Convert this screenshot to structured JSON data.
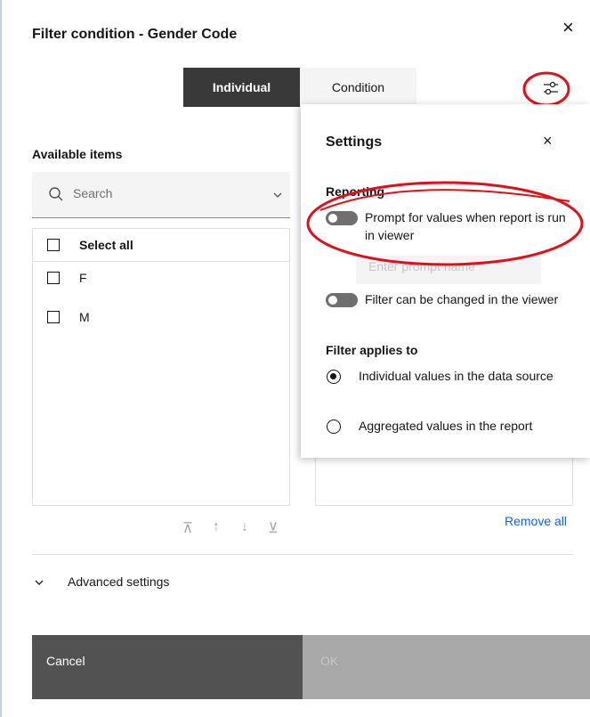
{
  "dialog": {
    "title": "Filter condition - Gender Code",
    "close_glyph": "×"
  },
  "tabs": [
    {
      "label": "Individual",
      "selected": true
    },
    {
      "label": "Condition",
      "selected": false
    }
  ],
  "icons": {
    "settings": "settings-adjust-icon",
    "search": "search-icon",
    "chevron": "chevron-down-icon"
  },
  "available": {
    "label": "Available items",
    "search_placeholder": "Search",
    "select_all": "Select all",
    "items": [
      "F",
      "M"
    ]
  },
  "reorder": {
    "top": "⊼",
    "up": "↑",
    "down": "↓",
    "bottom": "⊻"
  },
  "selected_panel": {
    "remove_all": "Remove all"
  },
  "advanced": {
    "label": "Advanced settings"
  },
  "footer": {
    "cancel": "Cancel",
    "ok": "OK"
  },
  "settings": {
    "title": "Settings",
    "close_glyph": "×",
    "reporting_label": "Reporting",
    "prompt_toggle_label": "Prompt for values when report is run in viewer",
    "prompt_toggle_on": false,
    "prompt_name_placeholder": "Enter prompt name",
    "filter_toggle_label": "Filter can be changed in the viewer",
    "filter_toggle_on": false,
    "applies_label": "Filter applies to",
    "options": [
      {
        "label": "Individual values in the data source",
        "checked": true
      },
      {
        "label": "Aggregated values in the report",
        "checked": false
      }
    ]
  },
  "colors": {
    "primary_dark": "#393939",
    "link": "#0f62fe",
    "annotation": "#e0101b"
  }
}
